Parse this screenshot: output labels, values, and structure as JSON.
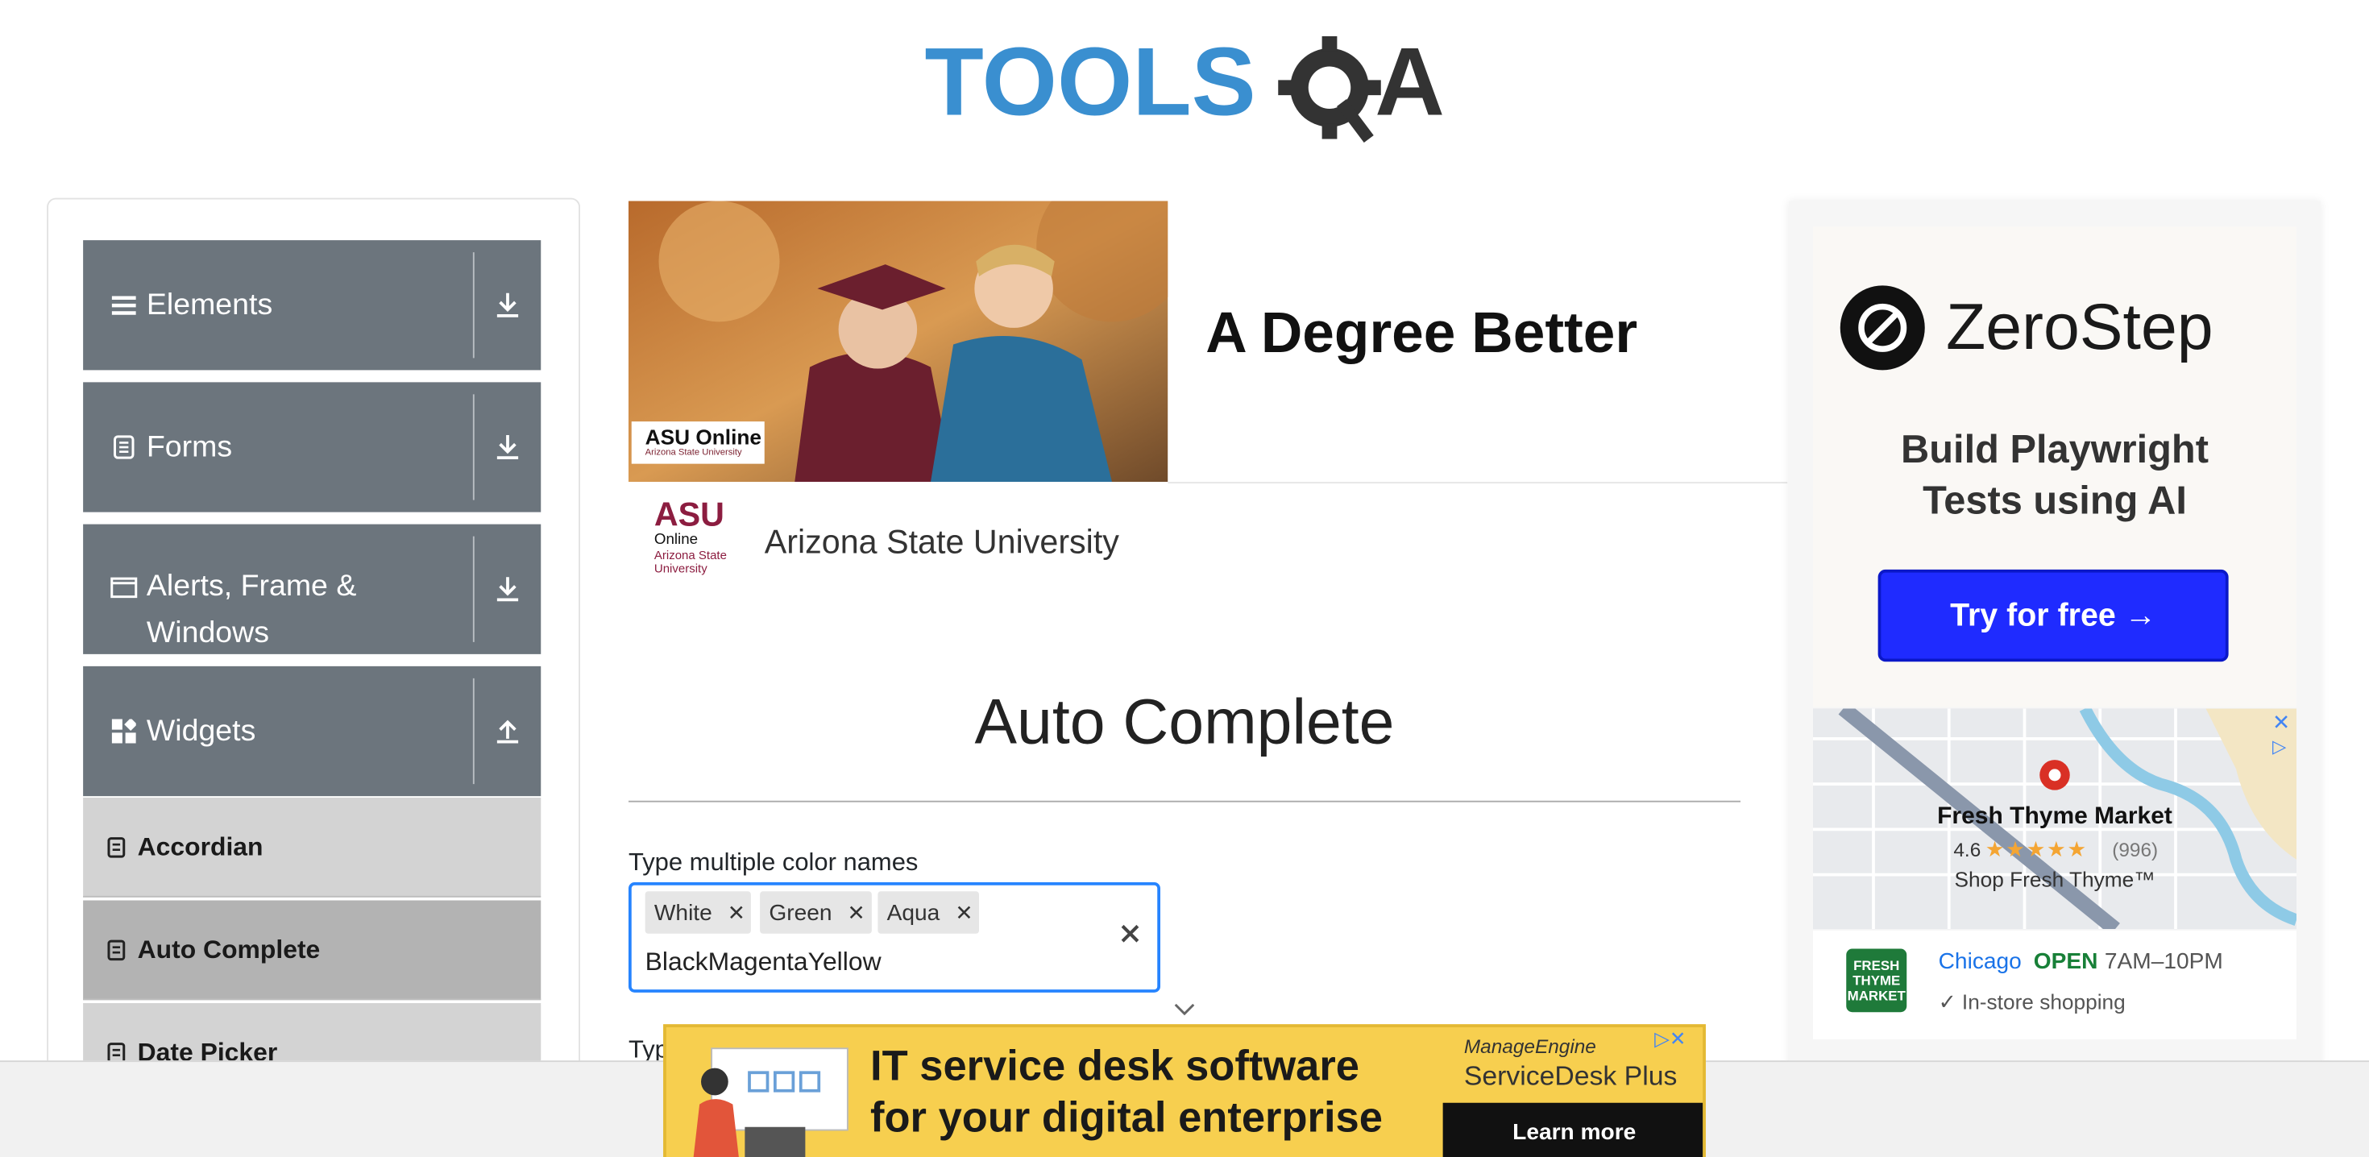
{
  "brand": {
    "logo_text": "TOOLSQA"
  },
  "sidebar": {
    "groups": [
      {
        "label": "Elements",
        "icon": "list-icon",
        "arrow": "download-icon"
      },
      {
        "label": "Forms",
        "icon": "form-icon",
        "arrow": "download-icon"
      },
      {
        "label": "Alerts, Frame & Windows",
        "icon": "window-icon",
        "arrow": "download-icon"
      },
      {
        "label": "Widgets",
        "icon": "widgets-icon",
        "arrow": "upload-icon"
      }
    ],
    "items": [
      {
        "label": "Accordian"
      },
      {
        "label": "Auto Complete",
        "active": true
      },
      {
        "label": "Date Picker"
      }
    ]
  },
  "top_ad": {
    "headline": "A Degree Better",
    "advertiser": "Arizona State University",
    "badge": "ASU Online",
    "badge_sub": "Arizona State University",
    "logo_main": "ASU",
    "logo_sub1": "Online",
    "logo_sub2": "Arizona State University"
  },
  "main": {
    "title": "Auto Complete",
    "multi": {
      "label": "Type multiple color names",
      "chips": [
        "White",
        "Green",
        "Aqua"
      ],
      "typed": "BlackMagentaYellow"
    },
    "single": {
      "label": "Typ"
    }
  },
  "right_ad": {
    "brand": "ZeroStep",
    "tagline_1": "Build Playwright",
    "tagline_2": "Tests using AI",
    "cta": "Try for free →",
    "store": {
      "name": "Fresh Thyme Market",
      "rating": "4.6",
      "stars": "★★★★★",
      "count": "(996)",
      "tagline": "Shop Fresh Thyme™",
      "logo": "FRESH THYME MARKET",
      "city": "Chicago",
      "status": "OPEN",
      "hours": "7AM–10PM",
      "feature": "✓ In-store shopping"
    }
  },
  "bottom_ad": {
    "line1": "IT service desk software",
    "line2": "for your digital enterprise",
    "brand": "ManageEngine",
    "product": "ServiceDesk Plus",
    "cta": "Learn more"
  },
  "colors": {
    "sidebar_group": "#6c757d",
    "focus": "#2684ff",
    "zerostep_blue": "#1f2bff",
    "banner_yellow": "#f7cf4f"
  }
}
